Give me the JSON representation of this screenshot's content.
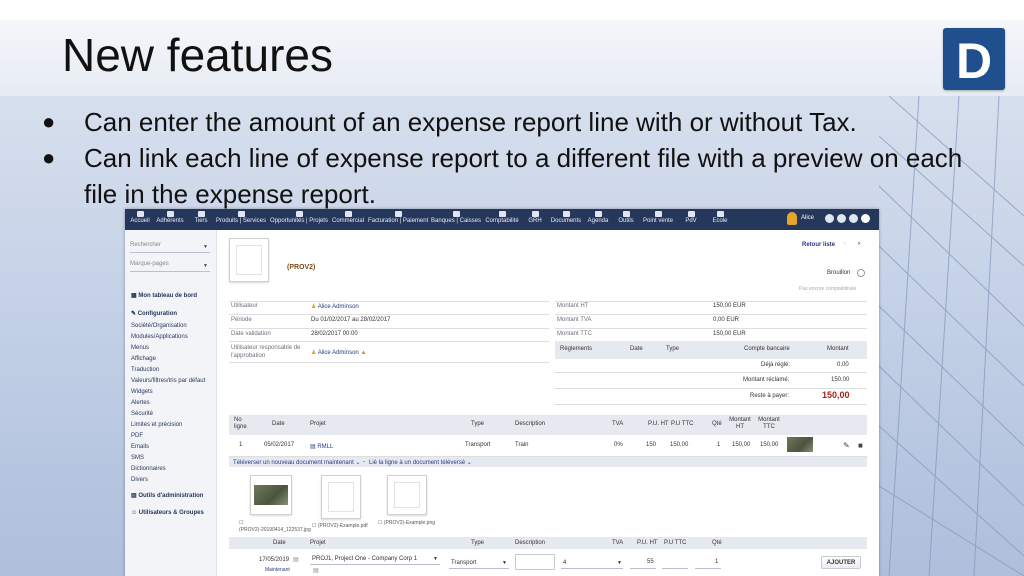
{
  "slide": {
    "title": "New features",
    "logo_letter": "D",
    "bullets": [
      "Can enter the amount of an expense report line with or without Tax.",
      "Can link each line of expense report to a different file with a preview on each file in the expense report."
    ]
  },
  "app": {
    "topnav": [
      {
        "label": "Accueil",
        "icon": "home-icon"
      },
      {
        "label": "Adhérents",
        "icon": "members-icon"
      },
      {
        "label": "Tiers",
        "icon": "building-icon"
      },
      {
        "label": "Produits | Services",
        "icon": "cube-icon"
      },
      {
        "label": "Opportunités | Projets",
        "icon": "sitemap-icon"
      },
      {
        "label": "Commercial",
        "icon": "suitcase-icon"
      },
      {
        "label": "Facturation | Paiement",
        "icon": "money-icon"
      },
      {
        "label": "Banques | Caisses",
        "icon": "bank-icon"
      },
      {
        "label": "Comptabilité",
        "icon": "ledger-icon"
      },
      {
        "label": "GRH",
        "icon": "id-card-icon"
      },
      {
        "label": "Documents",
        "icon": "folder-icon"
      },
      {
        "label": "Agenda",
        "icon": "calendar-icon"
      },
      {
        "label": "Outils",
        "icon": "wrench-icon"
      },
      {
        "label": "Point vente",
        "icon": "cash-register-icon"
      },
      {
        "label": "PdV",
        "icon": "pos-icon"
      },
      {
        "label": "Ecole",
        "icon": "school-icon"
      }
    ],
    "user": {
      "name": "Alice"
    },
    "left_menu": {
      "search_placeholder": "Rechercher",
      "bookmarks_placeholder": "Marque-pages",
      "dashboard": "Mon tableau de bord",
      "config_title": "Configuration",
      "config_items": [
        "Société/Organisation",
        "Modules/Applications",
        "Menus",
        "Affichage",
        "Traduction",
        "Valeurs/filtres/tris par défaut",
        "Widgets",
        "Alertes",
        "Sécurité",
        "Limites et précision",
        "PDF",
        "Emails",
        "SMS",
        "Dictionnaires",
        "Divers"
      ],
      "admin_tools": "Outils d'administration",
      "users_groups": "Utilisateurs & Groupes"
    },
    "report": {
      "ref": "(PROV2)",
      "back_to_list": "Retour liste",
      "status": "Brouillon",
      "not_accounted": "Pas encore comptabilisée",
      "fields": [
        {
          "label": "Utilisateur",
          "value": "Alice Adminson"
        },
        {
          "label": "Période",
          "value": "Du 01/02/2017 au 28/02/2017"
        },
        {
          "label": "Date validation",
          "value": "28/02/2017 00:00"
        },
        {
          "label": "Utilisateur responsable de l'approbation",
          "value": "Alice Adminson"
        }
      ],
      "amounts": [
        {
          "label": "Montant HT",
          "value": "150,00 EUR"
        },
        {
          "label": "Montant TVA",
          "value": "0,00 EUR"
        },
        {
          "label": "Montant TTC",
          "value": "150,00 EUR"
        }
      ],
      "payments_head": {
        "col1": "Règlements",
        "col2": "Date",
        "col3": "Type",
        "col4": "Compte bancaire",
        "col5": "Montant"
      },
      "already_paid": {
        "label": "Déjà réglé:",
        "value": "0,00"
      },
      "claimed": {
        "label": "Montant réclamé:",
        "value": "150,00"
      },
      "remain": {
        "label": "Reste à payer:",
        "value": "150,00"
      }
    },
    "lines": {
      "headers": {
        "no_line": "No ligne",
        "date": "Date",
        "project": "Projet",
        "type": "Type",
        "desc": "Description",
        "vat": "TVA",
        "pu_ht": "P.U. HT",
        "pu_ttc": "P.U TTC",
        "qty": "Qté",
        "amount_ht": "Montant HT",
        "amount_ttc": "Montant TTC"
      },
      "rows": [
        {
          "no": "1",
          "date": "05/02/2017",
          "project": "RMLL",
          "type": "Transport",
          "desc": "Train",
          "vat": "0%",
          "pu_ht": "150",
          "pu_ttc": "150,00",
          "qty": "1",
          "amount_ht": "150,00",
          "amount_ttc": "150,00"
        }
      ],
      "upload_link": "Téléverser un nouveau document maintenant",
      "link_existing": "Lié la ligne à un document téléversé",
      "files": [
        {
          "name": "(PROV2)-20190414_122537.jpg"
        },
        {
          "name": "(PROV2)-Example.pdf"
        },
        {
          "name": "(PROV2)-Example.png"
        }
      ]
    },
    "addline": {
      "headers": {
        "date": "Date",
        "project": "Projet",
        "type": "Type",
        "desc": "Description",
        "vat": "TVA",
        "pu_ht": "P.U. HT",
        "pu_ttc": "P.U TTC",
        "qty": "Qté"
      },
      "date": "17/05/2019",
      "now_link": "Maintenant",
      "project": "PROJ1, Project One - Company Corp 1",
      "type": "Transport",
      "vat": "4",
      "pu_ht": "55",
      "qty": "1",
      "add_button": "AJOUTER"
    }
  }
}
